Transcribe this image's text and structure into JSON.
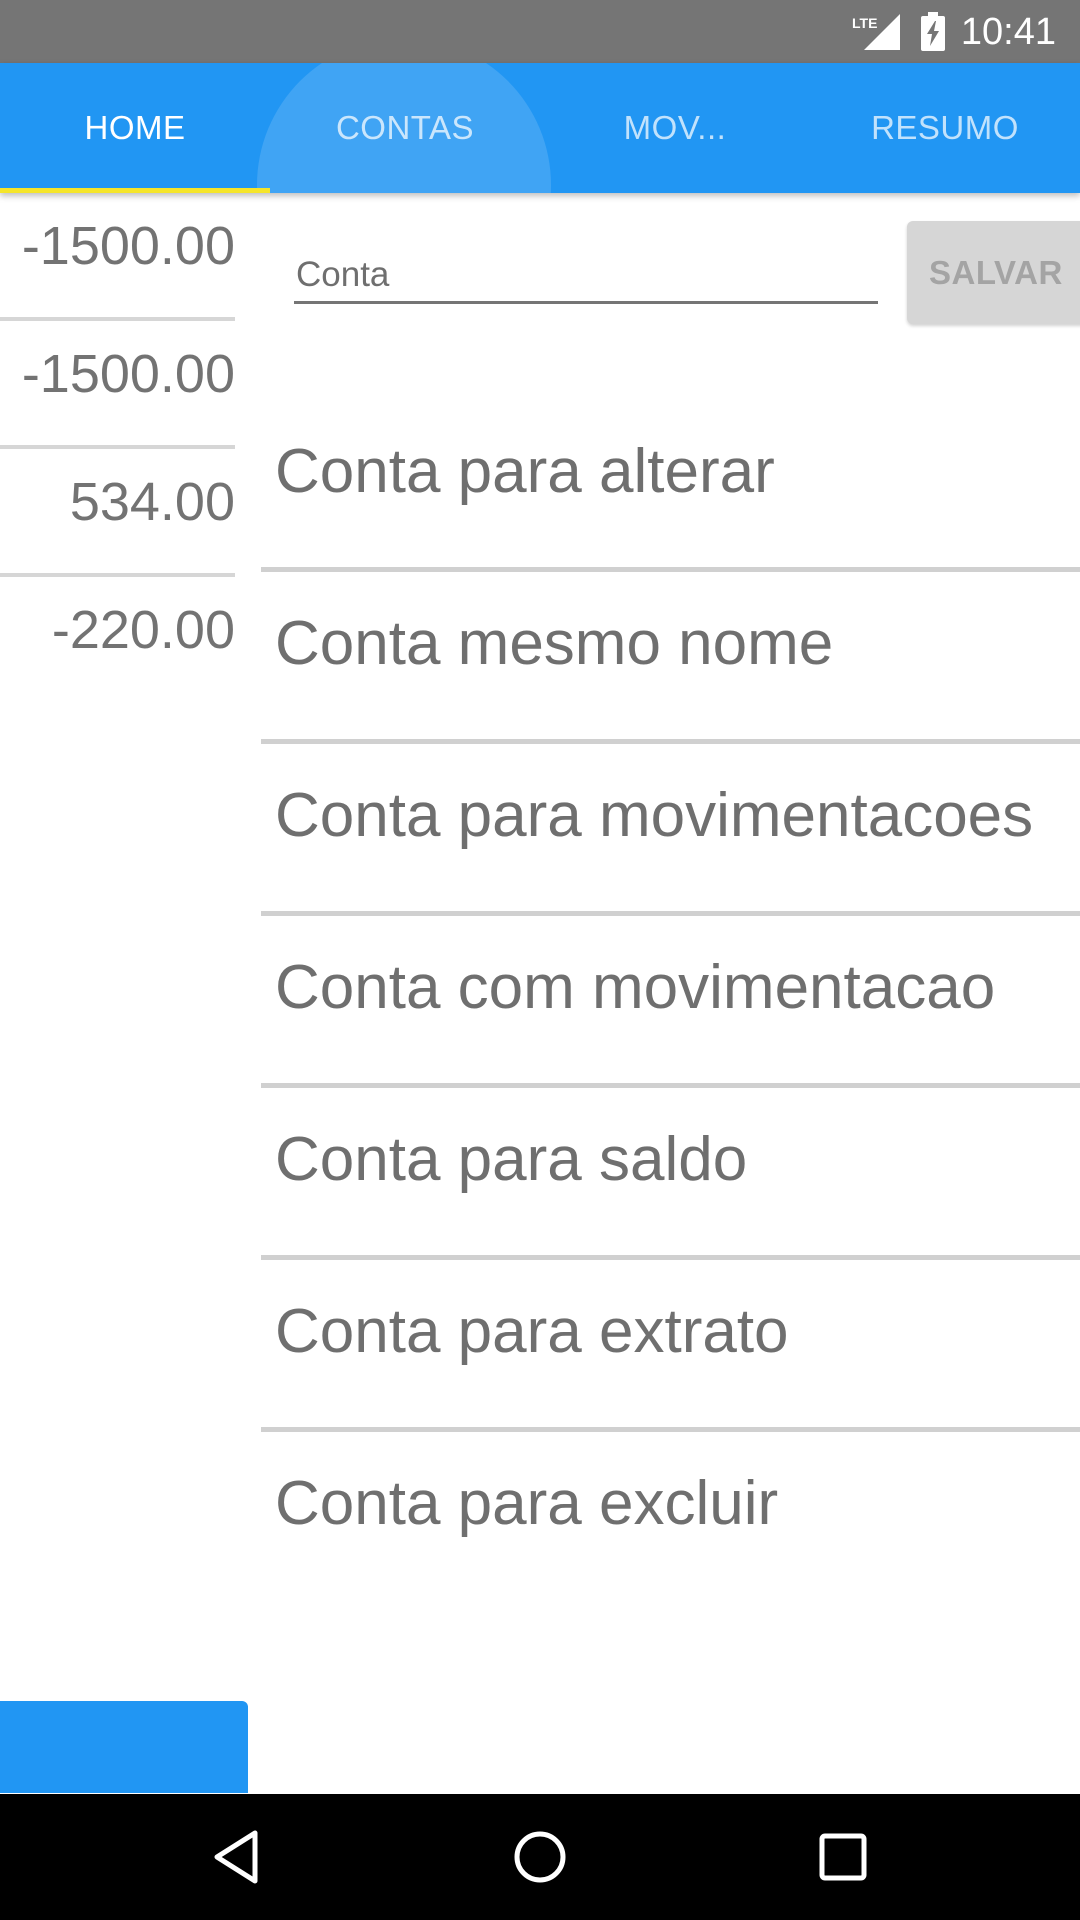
{
  "status_bar": {
    "network_label": "LTE",
    "time": "10:41",
    "icons": [
      "lte-signal-icon",
      "battery-charging-icon"
    ]
  },
  "tabs": [
    {
      "label": "HOME",
      "active": true
    },
    {
      "label": "CONTAS",
      "active": false
    },
    {
      "label": "MOV...",
      "active": false
    },
    {
      "label": "RESUMO",
      "active": false
    }
  ],
  "balances": [
    "-1500.00",
    "-1500.00",
    "534.00",
    "-220.00"
  ],
  "account_form": {
    "placeholder": "Conta",
    "value": "",
    "save_label": "SALVAR"
  },
  "accounts": [
    "Conta para alterar",
    "Conta mesmo nome",
    "Conta para movimentacoes",
    "Conta com movimentacao",
    "Conta para saldo",
    "Conta para extrato",
    "Conta para excluir"
  ],
  "nav_bar": {
    "icons": [
      "back-icon",
      "home-icon",
      "recents-icon"
    ]
  },
  "colors": {
    "primary": "#2196f3",
    "status_bar": "#757575",
    "tab_indicator": "#f5e52a",
    "text_gray": "#6f6f6f"
  }
}
